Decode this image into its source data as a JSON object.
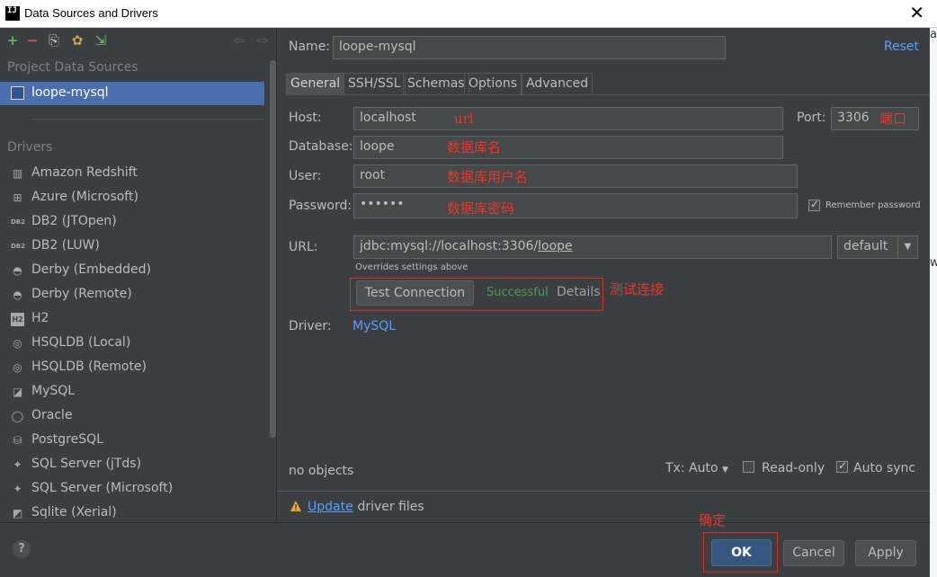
{
  "window": {
    "title": "Data Sources and Drivers",
    "close_glyph": "✕"
  },
  "toolbar": {
    "add": "+",
    "remove": "−",
    "copy": "⎘",
    "config": "✿",
    "import": "⇲",
    "back": "⇦",
    "forward": "⇨"
  },
  "sidebar": {
    "project_header": "Project Data Sources",
    "datasources": [
      {
        "label": "loope-mysql"
      }
    ],
    "drivers_header": "Drivers",
    "drivers": [
      {
        "label": "Amazon Redshift",
        "icon": "▥"
      },
      {
        "label": "Azure (Microsoft)",
        "icon": "⊞"
      },
      {
        "label": "DB2 (JTOpen)",
        "icon": "DB2"
      },
      {
        "label": "DB2 (LUW)",
        "icon": "DB2"
      },
      {
        "label": "Derby (Embedded)",
        "icon": "◓"
      },
      {
        "label": "Derby (Remote)",
        "icon": "◓"
      },
      {
        "label": "H2",
        "icon": "H2"
      },
      {
        "label": "HSQLDB (Local)",
        "icon": "◎"
      },
      {
        "label": "HSQLDB (Remote)",
        "icon": "◎"
      },
      {
        "label": "MySQL",
        "icon": "◪"
      },
      {
        "label": "Oracle",
        "icon": "◯"
      },
      {
        "label": "PostgreSQL",
        "icon": "⛁"
      },
      {
        "label": "SQL Server (jTds)",
        "icon": "✦"
      },
      {
        "label": "SQL Server (Microsoft)",
        "icon": "✦"
      },
      {
        "label": "Sqlite (Xerial)",
        "icon": "◩"
      }
    ]
  },
  "main": {
    "name_label": "Name:",
    "name_value": "loope-mysql",
    "reset": "Reset",
    "tabs": [
      "General",
      "SSH/SSL",
      "Schemas",
      "Options",
      "Advanced"
    ],
    "host_label": "Host:",
    "host_value": "localhost",
    "port_label": "Port:",
    "port_value": "3306",
    "database_label": "Database:",
    "database_value": "loope",
    "user_label": "User:",
    "user_value": "root",
    "password_label": "Password:",
    "password_value": "••••••",
    "remember_password": "Remember password",
    "url_label": "URL:",
    "url_prefix": "jdbc:mysql://localhost:3306/",
    "url_db": "loope",
    "url_mode": "default",
    "overrides_note": "Overrides settings above",
    "test_connection": "Test Connection",
    "test_status": "Successful",
    "details": "Details",
    "driver_label": "Driver:",
    "driver_value": "MySQL",
    "objects_status": "no objects",
    "tx_label": "Tx: Auto",
    "readonly_label": "Read-only",
    "autosync_label": "Auto sync",
    "update_link": "Update",
    "driver_files": " driver files"
  },
  "annotations": {
    "host": "url",
    "port": "端口",
    "database": "数据库名",
    "user": "数据库用户名",
    "password": "数据库密码",
    "test": "测试连接",
    "ok": "确定"
  },
  "footer": {
    "help": "?",
    "ok": "OK",
    "cancel": "Cancel",
    "apply": "Apply"
  },
  "edge_chars": [
    "a",
    "w"
  ],
  "colors": {
    "accent": "#589df6",
    "selection": "#4b6eaf",
    "success": "#499c54",
    "annotation": "#e8362a"
  }
}
